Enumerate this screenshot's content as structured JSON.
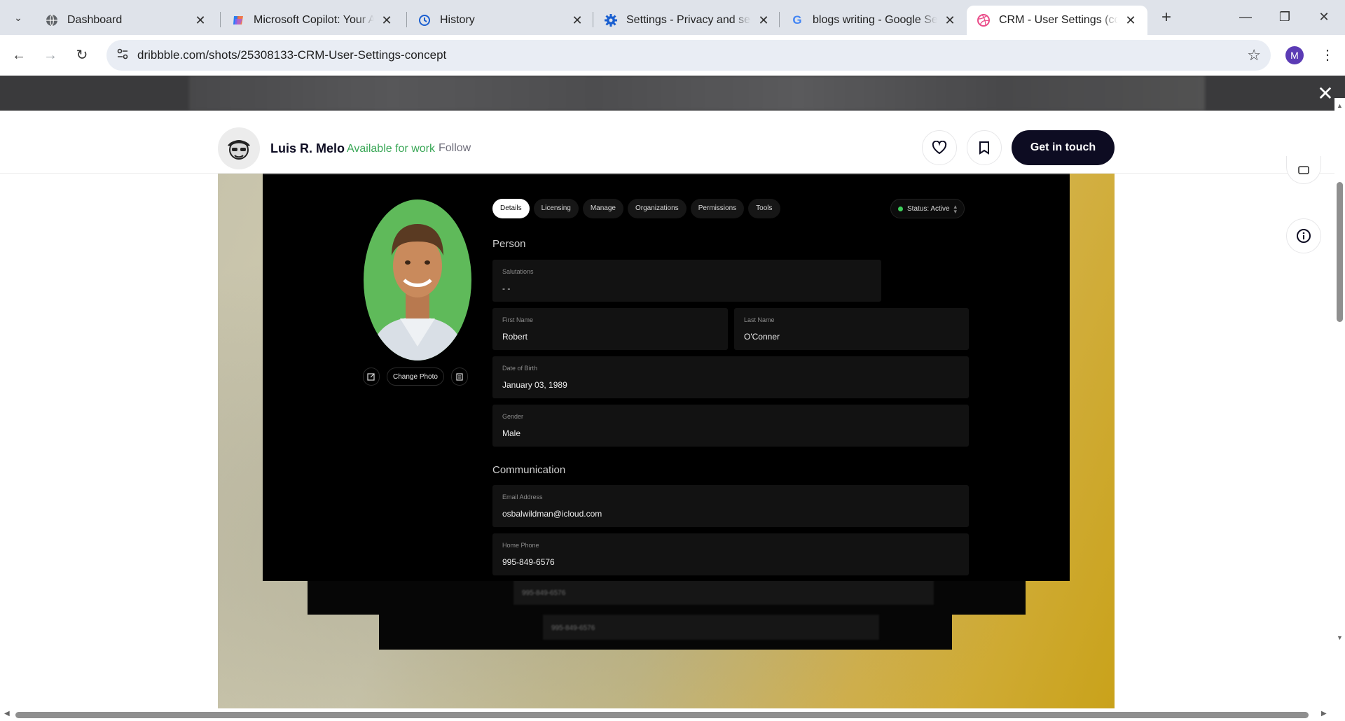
{
  "browser": {
    "tabs": [
      {
        "label": "Dashboard",
        "icon": "globe-icon"
      },
      {
        "label": "Microsoft Copilot: Your AI companion",
        "icon": "copilot-icon"
      },
      {
        "label": "History",
        "icon": "history-icon"
      },
      {
        "label": "Settings - Privacy and security",
        "icon": "gear-icon"
      },
      {
        "label": "blogs writing - Google Search",
        "icon": "google-icon"
      },
      {
        "label": "CRM - User Settings (concept)",
        "icon": "dribbble-icon"
      }
    ],
    "url": "dribbble.com/shots/25308133-CRM-User-Settings-concept",
    "profile_initial": "M"
  },
  "shot": {
    "designer_name": "Luis R. Melo",
    "availability": "Available for work",
    "follow_label": "Follow",
    "cta_label": "Get in touch"
  },
  "crm": {
    "tabs": [
      "Details",
      "Licensing",
      "Manage",
      "Organizations",
      "Permissions",
      "Tools"
    ],
    "status": "Status: Active",
    "change_photo": "Change Photo",
    "person_title": "Person",
    "communication_title": "Communication",
    "fields": {
      "salutations": {
        "label": "Salutations",
        "value": "- -"
      },
      "first_name": {
        "label": "First Name",
        "value": "Robert"
      },
      "last_name": {
        "label": "Last Name",
        "value": "O'Conner"
      },
      "dob": {
        "label": "Date of Birth",
        "value": "January 03, 1989"
      },
      "gender": {
        "label": "Gender",
        "value": "Male"
      },
      "email": {
        "label": "Email Address",
        "value": "osbalwildman@icloud.com"
      },
      "home_phone": {
        "label": "Home Phone",
        "value": "995-849-6576"
      }
    },
    "ghost_phone_1": "995-849-6576",
    "ghost_phone_2": "995-849-6576"
  },
  "colors": {
    "accent_dark": "#0d0c22",
    "available_green": "#3aa757",
    "status_green": "#3ccf5a",
    "photo_bg": "#5fba5a"
  }
}
